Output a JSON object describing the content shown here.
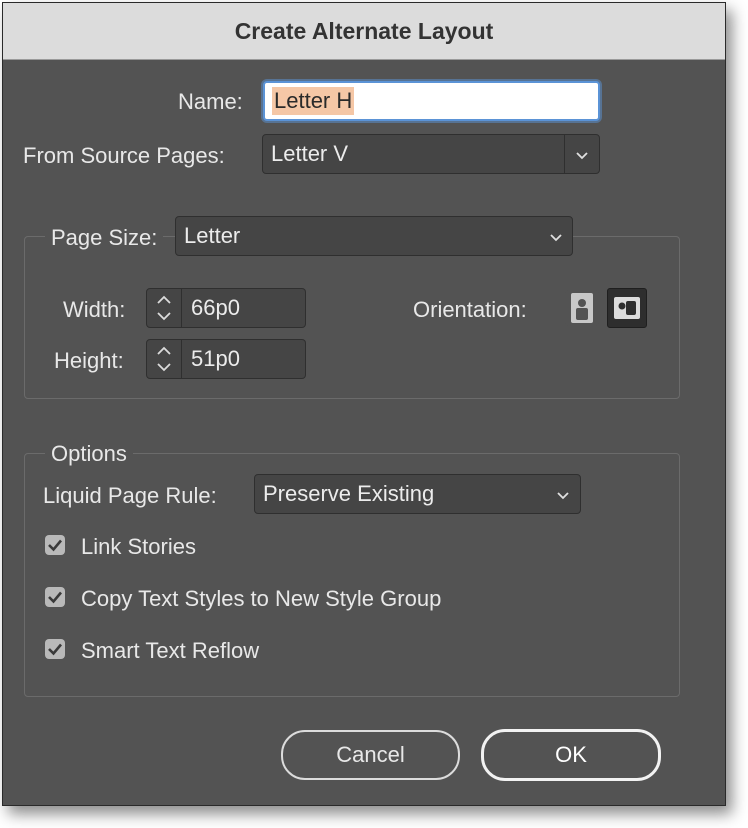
{
  "dialog": {
    "title": "Create Alternate Layout"
  },
  "name": {
    "label": "Name:",
    "value": "Letter H"
  },
  "source_pages": {
    "label": "From Source Pages:",
    "value": "Letter V"
  },
  "page_size": {
    "label": "Page Size:",
    "value": "Letter",
    "width_label": "Width:",
    "width_value": "66p0",
    "height_label": "Height:",
    "height_value": "51p0",
    "orientation_label": "Orientation:",
    "orientation_selected": "landscape"
  },
  "options": {
    "legend": "Options",
    "liquid_rule_label": "Liquid Page Rule:",
    "liquid_rule_value": "Preserve Existing",
    "checkboxes": [
      {
        "label": "Link Stories",
        "checked": true
      },
      {
        "label": "Copy Text Styles to New Style Group",
        "checked": true
      },
      {
        "label": "Smart Text Reflow",
        "checked": true
      }
    ]
  },
  "buttons": {
    "cancel": "Cancel",
    "ok": "OK"
  },
  "colors": {
    "dialog_bg": "#535353",
    "field_bg": "#454545",
    "focus_ring": "#5b93d6",
    "selection": "#f5c7a6"
  }
}
